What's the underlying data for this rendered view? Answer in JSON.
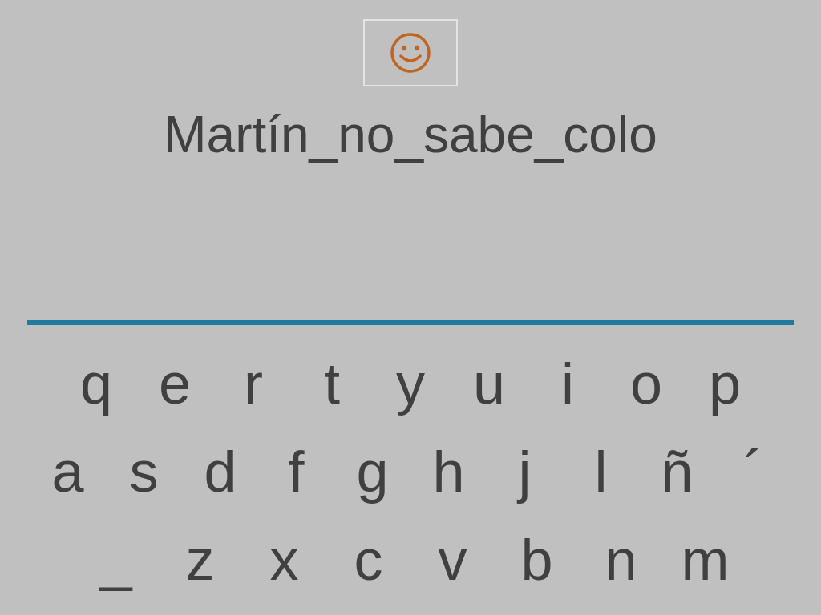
{
  "word": "Martín_no_sabe_colo",
  "keyboard": {
    "rows": [
      [
        "q",
        "e",
        "r",
        "t",
        "y",
        "u",
        "i",
        "o",
        "p"
      ],
      [
        "a",
        "s",
        "d",
        "f",
        "g",
        "h",
        "j",
        "l",
        "ñ",
        "´"
      ],
      [
        "_",
        "z",
        "x",
        "c",
        "v",
        "b",
        "n",
        "m"
      ]
    ]
  }
}
